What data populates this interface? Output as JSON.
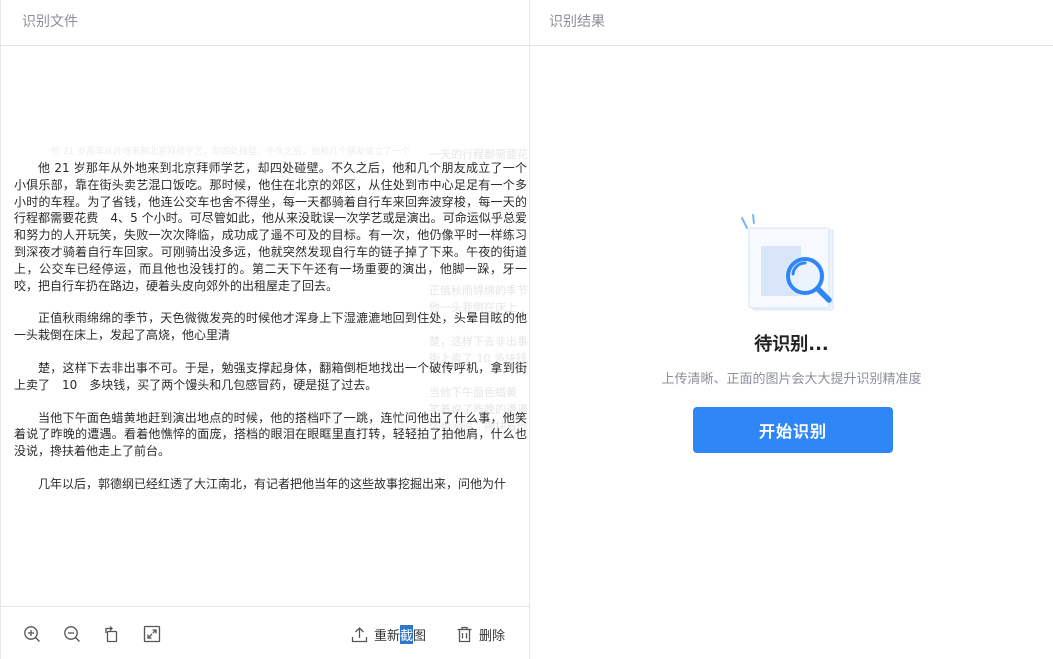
{
  "left_panel": {
    "title": "识别文件",
    "document": {
      "paragraphs": [
        "他 21 岁那年从外地来到北京拜师学艺，却四处碰壁。不久之后，他和几个朋友成立了一个小俱乐部，靠在街头卖艺混口饭吃。那时候，他住在北京的郊区，从住处到市中心足足有一个多小时的车程。为了省钱，他连公交车也舍不得坐，每一天都骑着自行车来回奔波穿梭，每一天的行程都需要花费　4、5 个小时。可尽管如此，他从来没耽误一次学艺或是演出。可命运似乎总爱和努力的人开玩笑，失败一次次降临，成功成了遥不可及的目标。有一次，他仍像平时一样练习到深夜才骑着自行车回家。可刚骑出没多远，他就突然发现自行车的链子掉了下来。午夜的街道上，公交车已经停运，而且他也没钱打的。第二天下午还有一场重要的演出，他脚一跺，牙一咬，把自行车扔在路边，硬着头皮向郊外的出租屋走了回去。",
        "正值秋雨绵绵的季节，天色微微发亮的时候他才浑身上下湿漉漉地回到住处，头晕目眩的他一头栽倒在床上，发起了高烧，他心里清",
        "楚，这样下去非出事不可。于是，勉强支撑起身体，翻箱倒柜地找出一个破传呼机，拿到街上卖了　10　多块钱，买了两个馒头和几包感冒药，硬是挺了过去。",
        "当他下午面色蜡黄地赶到演出地点的时候，他的搭档吓了一跳，连忙问他出了什么事，他笑着说了昨晚的遭遇。看着他憔悴的面庞，搭档的眼泪在眼眶里直打转，轻轻拍了拍他肩，什么也没说，搀扶着他走上了前台。",
        "几年以后，郭德纲已经红透了大江南北，有记者把他当年的这些故事挖掘出来，问他为什"
      ]
    },
    "toolbar": {
      "zoom_in": "zoom-in-icon",
      "zoom_out": "zoom-out-icon",
      "rotate": "rotate-icon",
      "fit": "fit-screen-icon",
      "recapture_pre": "重新",
      "recapture_hl": "截",
      "recapture_post": "图",
      "delete_label": "删除"
    }
  },
  "right_panel": {
    "title": "识别结果",
    "status_title": "待识别...",
    "hint": "上传清晰、正面的图片会大大提升识别精准度",
    "start_button": "开始识别"
  },
  "colors": {
    "accent": "#2f86f6",
    "border": "#e4e6ea",
    "muted_text": "#8c8f96"
  }
}
